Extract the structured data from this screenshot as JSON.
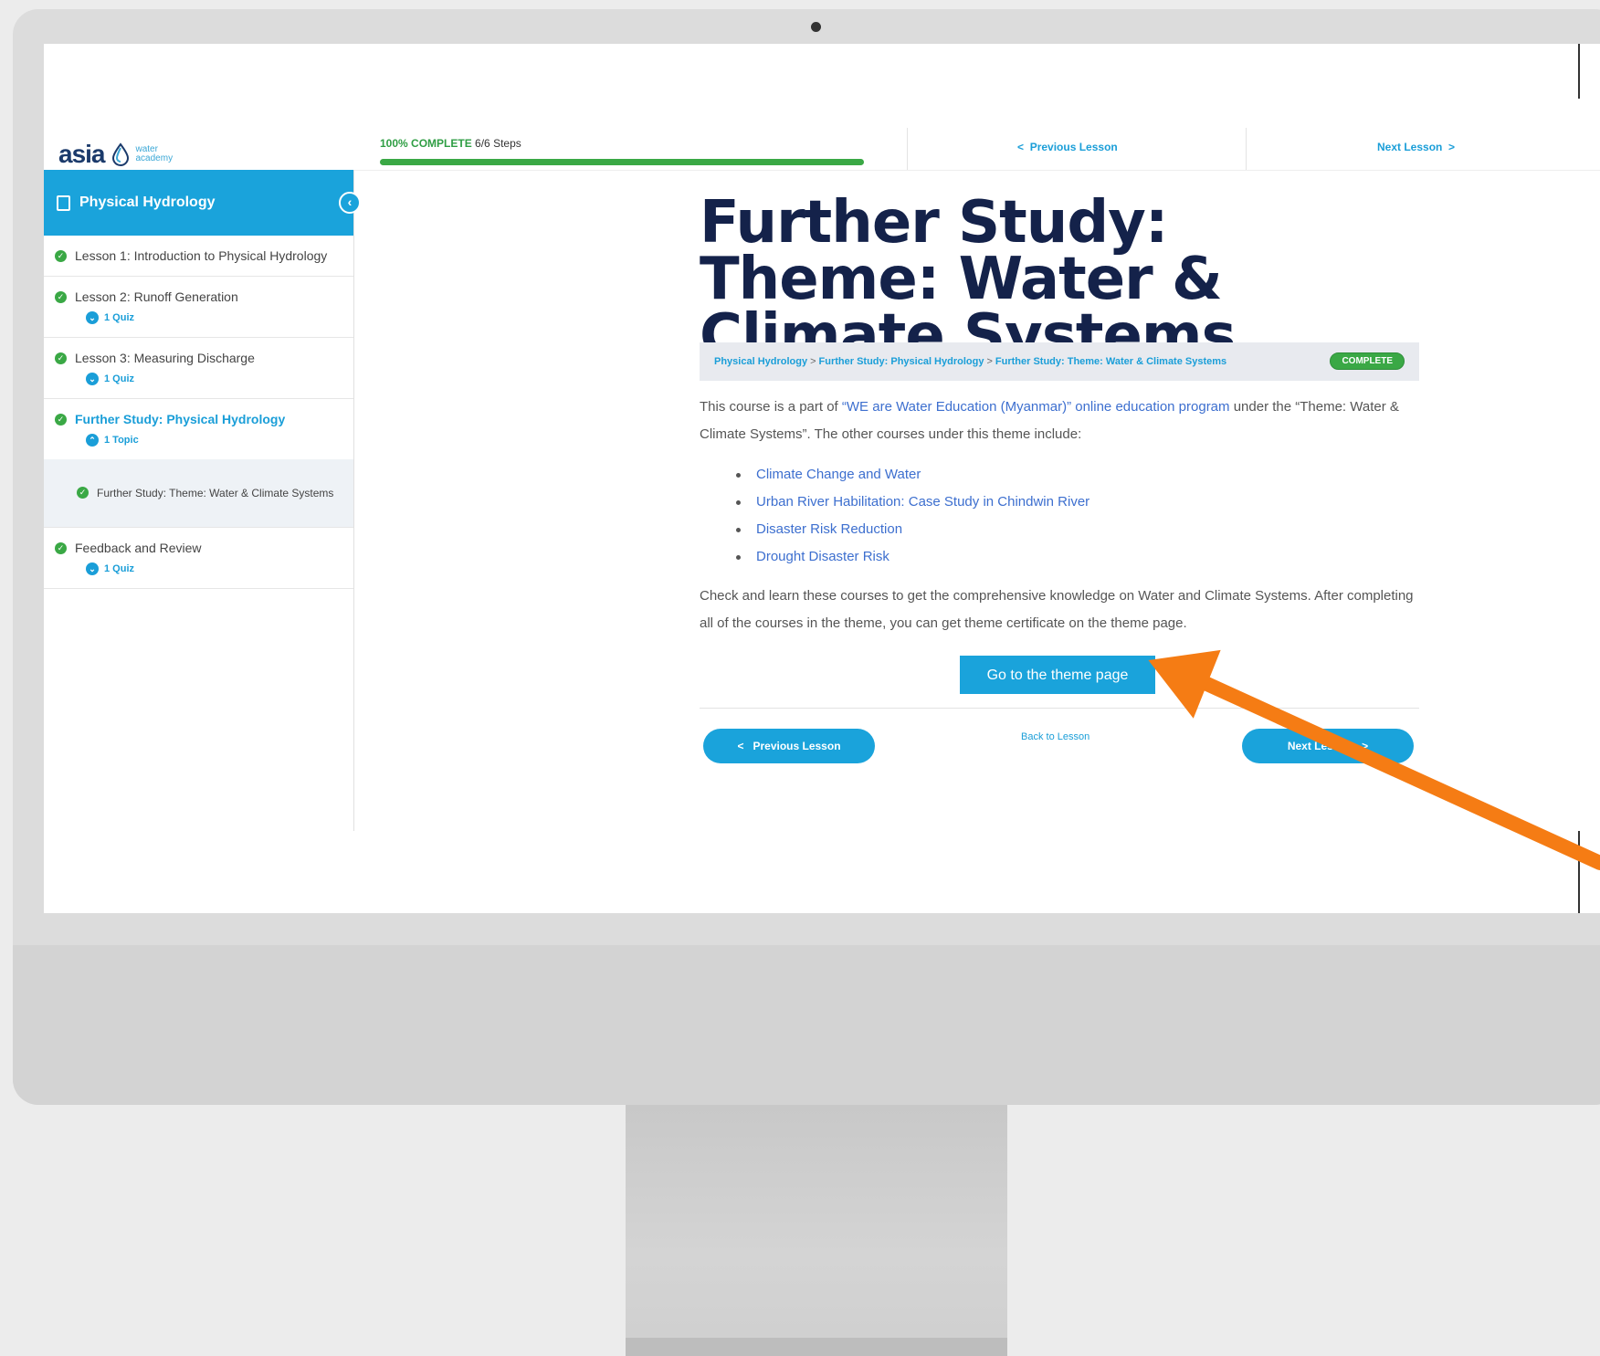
{
  "header": {
    "logo_word": "asia",
    "logo_sub_1": "water",
    "logo_sub_2": "academy",
    "progress_pct_label": "100% COMPLETE",
    "progress_steps": "6/6 Steps",
    "progress_fraction": 1.0,
    "prev_lesson": "Previous Lesson",
    "next_lesson": "Next Lesson"
  },
  "sidebar": {
    "course_title": "Physical Hydrology",
    "items": [
      {
        "label": "Lesson 1: Introduction to Physical Hydrology"
      },
      {
        "label": "Lesson 2: Runoff Generation",
        "badge": "1 Quiz"
      },
      {
        "label": "Lesson 3: Measuring Discharge",
        "badge": "1 Quiz"
      },
      {
        "label": "Further Study: Physical Hydrology",
        "badge": "1 Topic"
      },
      {
        "label": "Further Study: Theme: Water & Climate Systems"
      },
      {
        "label": "Feedback and Review",
        "badge": "1 Quiz"
      }
    ]
  },
  "main": {
    "title": "Further Study: Theme: Water & Climate Systems",
    "breadcrumb": [
      "Physical Hydrology",
      "Further Study: Physical Hydrology",
      "Further Study: Theme: Water & Climate Systems"
    ],
    "breadcrumb_sep": ">",
    "status_badge": "COMPLETE",
    "intro_pre": "This course is a part of ",
    "intro_link": "“WE are Water Education (Myanmar)” online education program",
    "intro_post": " under the “Theme: Water & Climate Systems”. The other courses under this theme include:",
    "courses": [
      "Climate Change and Water",
      "Urban River Habilitation: Case Study in Chindwin River",
      "Disaster Risk Reduction",
      "Drought Disaster Risk"
    ],
    "outro": "Check and learn these courses to get the comprehensive knowledge on Water and Climate Systems. After completing all of the courses in the theme, you can get theme certificate on the theme page.",
    "theme_button": "Go to the theme page",
    "prev_button": "Previous Lesson",
    "back_link": "Back to Lesson",
    "next_button": "Next Lesson"
  },
  "colors": {
    "accent": "#1aa3db",
    "title": "#14224a",
    "success": "#3aa845",
    "arrow": "#f57c14"
  }
}
